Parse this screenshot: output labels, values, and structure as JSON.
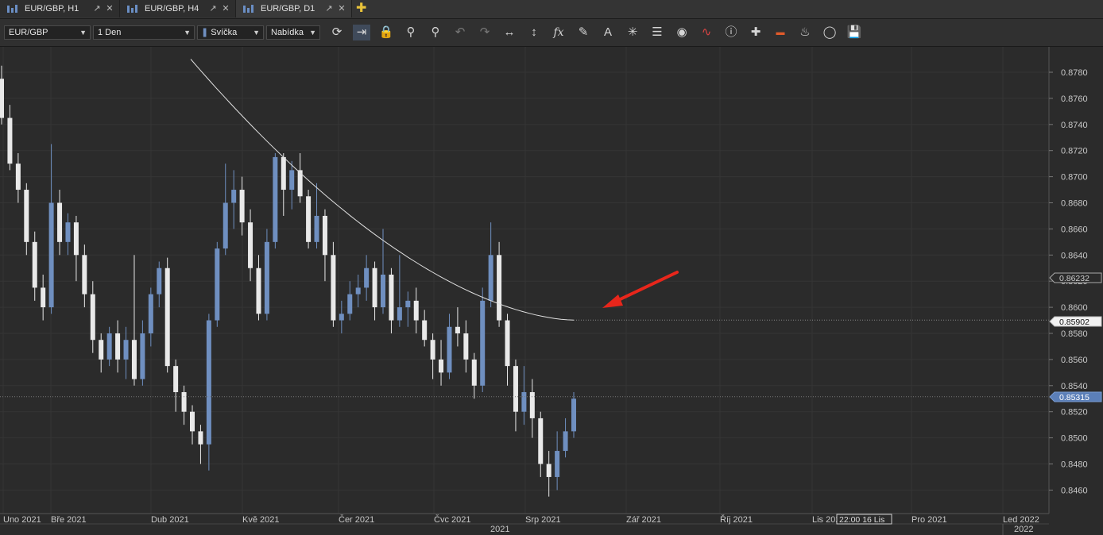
{
  "tabs": [
    {
      "label": "EUR/GBP, H1",
      "active": false
    },
    {
      "label": "EUR/GBP, H4",
      "active": false
    },
    {
      "label": "EUR/GBP, D1",
      "active": true
    }
  ],
  "toolbar": {
    "symbol": "EUR/GBP",
    "period": "1 Den",
    "chart_type": "Svíčka",
    "price_side": "Nabídka",
    "tools": [
      "refresh-icon",
      "shift-chart-icon",
      "lock-icon",
      "zoom-in-icon",
      "zoom-out-icon",
      "undo-icon",
      "redo-icon",
      "fit-horizontal-icon",
      "fit-vertical-icon",
      "indicators-fx-icon",
      "pencil-icon",
      "text-tool-icon",
      "crosshair-tool-icon",
      "layers-icon",
      "eye-icon",
      "chart-style-icon",
      "info-icon",
      "cursor-cross-icon",
      "color-bar-icon",
      "paint-bucket-icon",
      "template-ring-icon",
      "save-icon"
    ]
  },
  "price_axis": {
    "ticks": [
      "0.8780",
      "0.8760",
      "0.8740",
      "0.8720",
      "0.8700",
      "0.8680",
      "0.8660",
      "0.8640",
      "0.8620",
      "0.8600",
      "0.8580",
      "0.8560",
      "0.8540",
      "0.8520",
      "0.8500",
      "0.8480",
      "0.8460"
    ],
    "marker_high": "0.86232",
    "marker_ma": "0.85902",
    "marker_current": "0.85315"
  },
  "time_axis": {
    "months": [
      "Uno 2021",
      "Bře 2021",
      "Dub 2021",
      "Kvě 2021",
      "Čer 2021",
      "Čvc 2021",
      "Srp 2021",
      "Zář 2021",
      "Říj 2021",
      "Lis 2021",
      "Pro 2021",
      "Led 2022"
    ],
    "cursor_label": "22:00 16 Lis",
    "year_label": "2021",
    "year_label_2": "2022"
  },
  "colors": {
    "background": "#2b2b2b",
    "bull_candle": "#6f8fc0",
    "bear_candle": "#e9e9e9",
    "ma_line": "#e0e0e0",
    "arrow": "#e8261b",
    "current_price_bg": "#5b7fb8"
  },
  "chart_data": {
    "type": "candlestick",
    "symbol": "EUR/GBP",
    "timeframe": "D1",
    "y_range": [
      0.8446,
      0.879
    ],
    "ma_line": [
      [
        0.879,
        0.879
      ],
      [
        0.8745,
        0.8736
      ],
      [
        0.872,
        0.8711
      ],
      [
        0.87,
        0.869
      ],
      [
        0.868,
        0.867
      ],
      [
        0.866,
        0.8651
      ],
      [
        0.8645,
        0.8636
      ],
      [
        0.863,
        0.8624
      ],
      [
        0.8615,
        0.8611
      ],
      [
        0.8605,
        0.8598
      ]
    ],
    "ma_last_value": 0.85902,
    "current_price": 0.85315,
    "candles": [
      [
        0.8775,
        0.8745,
        0.8785,
        0.874
      ],
      [
        0.8745,
        0.871,
        0.8755,
        0.8705
      ],
      [
        0.871,
        0.869,
        0.8718,
        0.868
      ],
      [
        0.869,
        0.865,
        0.8695,
        0.864
      ],
      [
        0.865,
        0.8615,
        0.8658,
        0.8605
      ],
      [
        0.8615,
        0.86,
        0.8625,
        0.859
      ],
      [
        0.86,
        0.868,
        0.8725,
        0.8595
      ],
      [
        0.868,
        0.865,
        0.869,
        0.864
      ],
      [
        0.865,
        0.8665,
        0.8672,
        0.864
      ],
      [
        0.8665,
        0.864,
        0.867,
        0.862
      ],
      [
        0.864,
        0.861,
        0.8648,
        0.86
      ],
      [
        0.861,
        0.8575,
        0.862,
        0.8565
      ],
      [
        0.8575,
        0.856,
        0.858,
        0.855
      ],
      [
        0.856,
        0.858,
        0.8585,
        0.8555
      ],
      [
        0.858,
        0.856,
        0.859,
        0.855
      ],
      [
        0.856,
        0.8575,
        0.8585,
        0.8545
      ],
      [
        0.8575,
        0.8545,
        0.864,
        0.854
      ],
      [
        0.8545,
        0.858,
        0.859,
        0.854
      ],
      [
        0.858,
        0.861,
        0.8615,
        0.857
      ],
      [
        0.861,
        0.863,
        0.8635,
        0.86
      ],
      [
        0.863,
        0.8555,
        0.8638,
        0.855
      ],
      [
        0.8555,
        0.8535,
        0.856,
        0.852
      ],
      [
        0.8535,
        0.852,
        0.854,
        0.851
      ],
      [
        0.852,
        0.8505,
        0.8525,
        0.8495
      ],
      [
        0.8505,
        0.8495,
        0.851,
        0.848
      ],
      [
        0.8495,
        0.859,
        0.8595,
        0.8475
      ],
      [
        0.859,
        0.8645,
        0.865,
        0.8585
      ],
      [
        0.8645,
        0.868,
        0.871,
        0.864
      ],
      [
        0.868,
        0.869,
        0.8705,
        0.866
      ],
      [
        0.869,
        0.8665,
        0.87,
        0.8655
      ],
      [
        0.8665,
        0.863,
        0.8675,
        0.862
      ],
      [
        0.863,
        0.8595,
        0.864,
        0.859
      ],
      [
        0.8595,
        0.865,
        0.866,
        0.859
      ],
      [
        0.865,
        0.8715,
        0.8718,
        0.8645
      ],
      [
        0.8715,
        0.869,
        0.8718,
        0.867
      ],
      [
        0.869,
        0.8705,
        0.8712,
        0.8675
      ],
      [
        0.8705,
        0.8685,
        0.8718,
        0.868
      ],
      [
        0.8685,
        0.865,
        0.869,
        0.8645
      ],
      [
        0.865,
        0.867,
        0.8695,
        0.8645
      ],
      [
        0.867,
        0.864,
        0.8675,
        0.862
      ],
      [
        0.864,
        0.859,
        0.865,
        0.8585
      ],
      [
        0.859,
        0.8595,
        0.8605,
        0.858
      ],
      [
        0.8595,
        0.861,
        0.862,
        0.859
      ],
      [
        0.861,
        0.8615,
        0.8625,
        0.86
      ],
      [
        0.8615,
        0.863,
        0.864,
        0.8605
      ],
      [
        0.863,
        0.86,
        0.8635,
        0.859
      ],
      [
        0.86,
        0.8625,
        0.866,
        0.8595
      ],
      [
        0.8625,
        0.859,
        0.863,
        0.858
      ],
      [
        0.859,
        0.86,
        0.864,
        0.8585
      ],
      [
        0.86,
        0.8605,
        0.8612,
        0.8585
      ],
      [
        0.8605,
        0.859,
        0.8615,
        0.858
      ],
      [
        0.859,
        0.8575,
        0.8598,
        0.857
      ],
      [
        0.8575,
        0.856,
        0.858,
        0.8545
      ],
      [
        0.856,
        0.855,
        0.8575,
        0.854
      ],
      [
        0.855,
        0.8585,
        0.8595,
        0.8545
      ],
      [
        0.8585,
        0.858,
        0.86,
        0.857
      ],
      [
        0.858,
        0.856,
        0.859,
        0.855
      ],
      [
        0.856,
        0.854,
        0.8565,
        0.853
      ],
      [
        0.854,
        0.8605,
        0.8615,
        0.8535
      ],
      [
        0.8605,
        0.864,
        0.8665,
        0.86
      ],
      [
        0.864,
        0.859,
        0.865,
        0.8585
      ],
      [
        0.859,
        0.8555,
        0.8595,
        0.854
      ],
      [
        0.8555,
        0.852,
        0.856,
        0.8505
      ],
      [
        0.852,
        0.8535,
        0.8555,
        0.851
      ],
      [
        0.8535,
        0.8515,
        0.8545,
        0.85
      ],
      [
        0.8515,
        0.848,
        0.852,
        0.847
      ],
      [
        0.848,
        0.847,
        0.849,
        0.8455
      ],
      [
        0.847,
        0.849,
        0.8505,
        0.846
      ],
      [
        0.849,
        0.8505,
        0.8515,
        0.8485
      ],
      [
        0.8505,
        0.853,
        0.8535,
        0.85
      ]
    ]
  }
}
